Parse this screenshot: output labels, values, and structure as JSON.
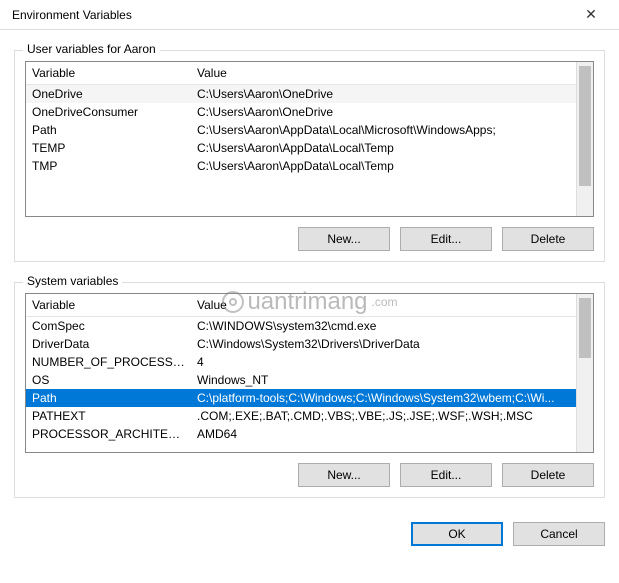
{
  "window": {
    "title": "Environment Variables",
    "close_glyph": "✕"
  },
  "user_group": {
    "label": "User variables for Aaron",
    "col_variable": "Variable",
    "col_value": "Value",
    "rows": [
      {
        "var": "OneDrive",
        "val": "C:\\Users\\Aaron\\OneDrive"
      },
      {
        "var": "OneDriveConsumer",
        "val": "C:\\Users\\Aaron\\OneDrive"
      },
      {
        "var": "Path",
        "val": "C:\\Users\\Aaron\\AppData\\Local\\Microsoft\\WindowsApps;"
      },
      {
        "var": "TEMP",
        "val": "C:\\Users\\Aaron\\AppData\\Local\\Temp"
      },
      {
        "var": "TMP",
        "val": "C:\\Users\\Aaron\\AppData\\Local\\Temp"
      }
    ],
    "btn_new": "New...",
    "btn_edit": "Edit...",
    "btn_delete": "Delete"
  },
  "system_group": {
    "label": "System variables",
    "col_variable": "Variable",
    "col_value": "Value",
    "rows": [
      {
        "var": "ComSpec",
        "val": "C:\\WINDOWS\\system32\\cmd.exe",
        "selected": false
      },
      {
        "var": "DriverData",
        "val": "C:\\Windows\\System32\\Drivers\\DriverData",
        "selected": false
      },
      {
        "var": "NUMBER_OF_PROCESSORS",
        "val": "4",
        "selected": false
      },
      {
        "var": "OS",
        "val": "Windows_NT",
        "selected": false
      },
      {
        "var": "Path",
        "val": "C:\\platform-tools;C:\\Windows;C:\\Windows\\System32\\wbem;C:\\Wi...",
        "selected": true
      },
      {
        "var": "PATHEXT",
        "val": ".COM;.EXE;.BAT;.CMD;.VBS;.VBE;.JS;.JSE;.WSF;.WSH;.MSC",
        "selected": false
      },
      {
        "var": "PROCESSOR_ARCHITECTURE",
        "val": "AMD64",
        "selected": false
      }
    ],
    "btn_new": "New...",
    "btn_edit": "Edit...",
    "btn_delete": "Delete"
  },
  "dialog": {
    "ok": "OK",
    "cancel": "Cancel"
  },
  "watermark": "uantrimang"
}
